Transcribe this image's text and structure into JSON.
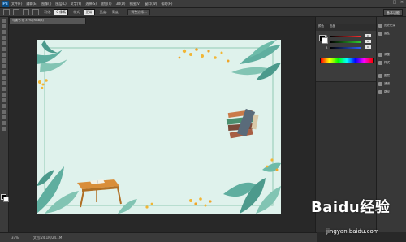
{
  "app": {
    "logo": "Ps"
  },
  "menu": [
    "文件(F)",
    "编辑(E)",
    "图像(I)",
    "图层(L)",
    "文字(Y)",
    "选择(S)",
    "滤镜(T)",
    "3D(D)",
    "视图(V)",
    "窗口(W)",
    "帮助(H)"
  ],
  "options": {
    "feather_label": "羽化:",
    "feather_value": "0 像素",
    "style_label": "样式:",
    "style_value": "正常",
    "width_label": "宽度:",
    "height_label": "高度:",
    "refine_button": "调整边缘..."
  },
  "workspace": {
    "label": "基本功能"
  },
  "document": {
    "tab_title": "与读书 @ 37% (RGB/8)"
  },
  "status": {
    "zoom": "37%",
    "doc_info": "文档:24.1M/24.1M"
  },
  "color_panel": {
    "tabs": [
      "颜色",
      "色板"
    ],
    "sliders": [
      {
        "label": "R",
        "value": "0",
        "color": "#d83a3a"
      },
      {
        "label": "G",
        "value": "0",
        "color": "#3abf3a"
      },
      {
        "label": "B",
        "value": "0",
        "color": "#3a6ad8"
      }
    ]
  },
  "side_panel": {
    "items": [
      "历史记录",
      "属性",
      "调整",
      "样式",
      "图层",
      "通道",
      "路径"
    ]
  },
  "watermark": {
    "brand": "Baidu经验",
    "url": "jingyan.baidu.com"
  },
  "colors": {
    "canvas_bg": "#dff2ec",
    "leaf_green": "#5fae9f",
    "flower_yellow": "#f2b634"
  }
}
